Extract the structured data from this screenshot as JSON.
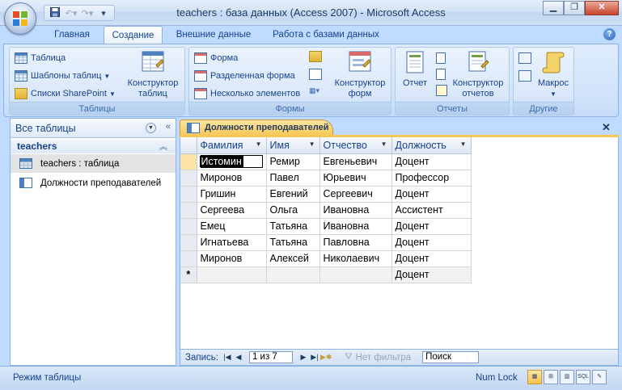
{
  "window": {
    "title": "teachers : база данных (Access 2007) - Microsoft Access",
    "minimize_icon": "minimize-icon",
    "maximize_icon": "restore-icon",
    "close_icon": "close-icon"
  },
  "qat": {
    "save_icon": "save-icon",
    "undo_icon": "undo-icon",
    "redo_icon": "redo-icon"
  },
  "tabs": [
    {
      "label": "Главная",
      "active": false
    },
    {
      "label": "Создание",
      "active": true
    },
    {
      "label": "Внешние данные",
      "active": false
    },
    {
      "label": "Работа с базами данных",
      "active": false
    }
  ],
  "ribbon": {
    "tables": {
      "table": "Таблица",
      "templates": "Шаблоны таблиц",
      "sharepoint": "Списки SharePoint",
      "designer_line1": "Конструктор",
      "designer_line2": "таблиц",
      "label": "Таблицы"
    },
    "forms": {
      "form": "Форма",
      "split_form": "Разделенная форма",
      "multiple_items": "Несколько элементов",
      "designer_line1": "Конструктор",
      "designer_line2": "форм",
      "label": "Формы"
    },
    "reports": {
      "report": "Отчет",
      "designer_line1": "Конструктор",
      "designer_line2": "отчетов",
      "label": "Отчеты"
    },
    "other": {
      "macro": "Макрос",
      "label": "Другие"
    }
  },
  "nav": {
    "header": "Все таблицы",
    "group": "teachers",
    "items": [
      {
        "label": "teachers : таблица",
        "selected": true,
        "icon": "table-icon"
      },
      {
        "label": "Должности преподавателей",
        "selected": false,
        "icon": "query-icon"
      }
    ]
  },
  "document": {
    "tab_title": "Должности преподавателей",
    "columns": [
      "Фамилия",
      "Имя",
      "Отчество",
      "Должность"
    ],
    "rows": [
      [
        "Истомин",
        "Ремир",
        "Евгеньевич",
        "Доцент"
      ],
      [
        "Миронов",
        "Павел",
        "Юрьевич",
        "Профессор"
      ],
      [
        "Гришин",
        "Евгений",
        "Сергеевич",
        "Доцент"
      ],
      [
        "Сергеева",
        "Ольга",
        "Ивановна",
        "Ассистент"
      ],
      [
        "Емец",
        "Татьяна",
        "Ивановна",
        "Доцент"
      ],
      [
        "Игнатьева",
        "Татьяна",
        "Павловна",
        "Доцент"
      ],
      [
        "Миронов",
        "Алексей",
        "Николаевич",
        "Доцент"
      ]
    ],
    "new_row": [
      "",
      "",
      "",
      "Доцент"
    ],
    "new_row_marker": "*"
  },
  "record_nav": {
    "label": "Запись:",
    "counter": "1 из 7",
    "filter": "Нет фильтра",
    "search": "Поиск"
  },
  "status": {
    "mode": "Режим таблицы",
    "numlock": "Num Lock",
    "sql": "SQL"
  }
}
